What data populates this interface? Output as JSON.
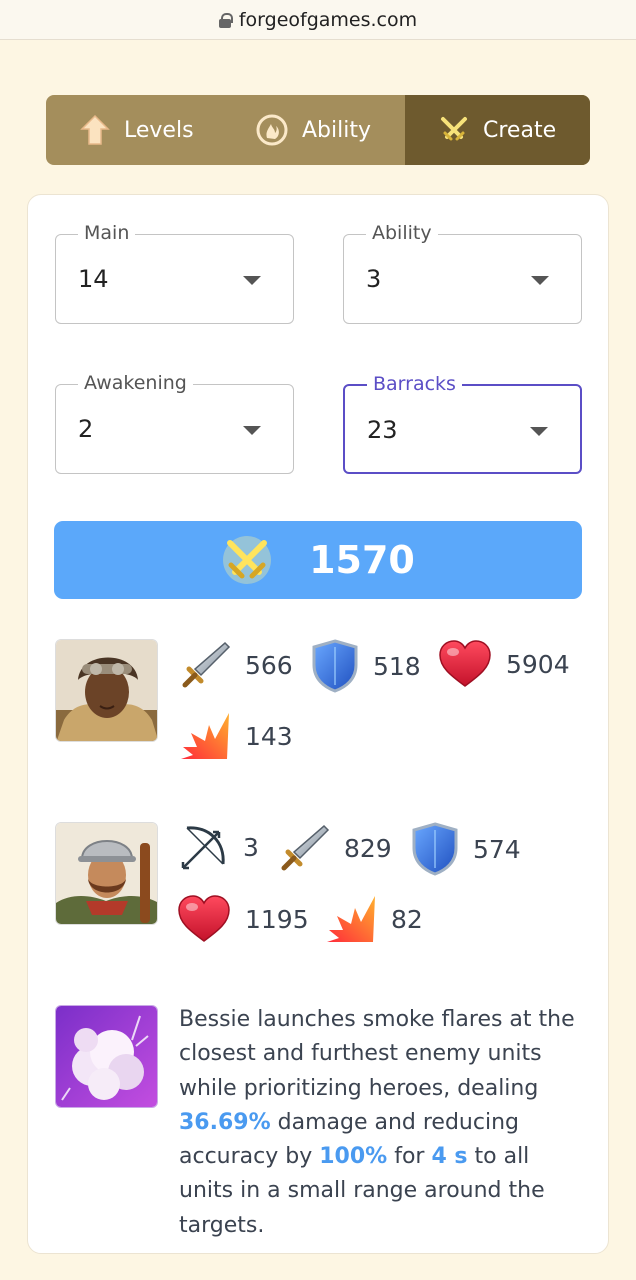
{
  "browser": {
    "url": "forgeofgames.com"
  },
  "tabs": [
    {
      "label": "Levels",
      "icon": "arrow-up-icon",
      "active": false
    },
    {
      "label": "Ability",
      "icon": "ability-flame-icon",
      "active": false
    },
    {
      "label": "Create",
      "icon": "crossed-swords-icon",
      "active": true
    }
  ],
  "selects": {
    "main": {
      "label": "Main",
      "value": "14"
    },
    "ability": {
      "label": "Ability",
      "value": "3"
    },
    "awakening": {
      "label": "Awakening",
      "value": "2"
    },
    "barracks": {
      "label": "Barracks",
      "value": "23",
      "focused": true
    }
  },
  "power": {
    "value": "1570",
    "color": "#5ba8fa"
  },
  "hero": {
    "attack": "566",
    "defense": "518",
    "health": "5904",
    "damage": "143"
  },
  "troop": {
    "range": "3",
    "attack": "829",
    "defense": "574",
    "health": "1195",
    "damage": "82"
  },
  "ability_desc": {
    "p1": "Bessie launches smoke flares at the closest and furthest enemy units while prioritizing heroes, dealing ",
    "v1": "36.69%",
    "p2": " damage and reducing accuracy by ",
    "v2": "100%",
    "p3": " for ",
    "v3": "4 s",
    "p4": " to all units in a small range around the targets."
  },
  "colors": {
    "accent": "#5b4ec6",
    "highlight": "#4a9af0",
    "tab_bg": "#a48e5c",
    "tab_active": "#6e5a2e"
  }
}
